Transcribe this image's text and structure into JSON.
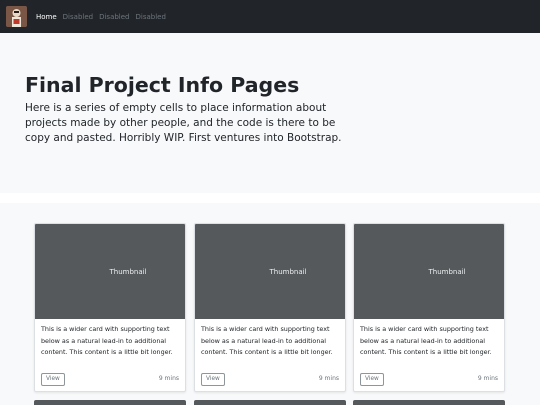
{
  "navbar": {
    "brand_icon": "avatar-logo",
    "links": [
      {
        "label": "Home",
        "state": "active"
      },
      {
        "label": "Disabled",
        "state": "disabled"
      },
      {
        "label": "Disabled",
        "state": "disabled"
      },
      {
        "label": "Disabled",
        "state": "disabled"
      }
    ]
  },
  "hero": {
    "title": "Final Project Info Pages",
    "lead": "Here is a series of empty cells to place information about projects made by other people, and the code is there to be copy and pasted. Horribly WIP. First ventures into Bootstrap."
  },
  "cards": [
    {
      "thumbnail": "Thumbnail",
      "text": "This is a wider card with supporting text below as a natural lead-in to additional content. This content is a little bit longer.",
      "button": "View",
      "time": "9 mins"
    },
    {
      "thumbnail": "Thumbnail",
      "text": "This is a wider card with supporting text below as a natural lead-in to additional content. This content is a little bit longer.",
      "button": "View",
      "time": "9 mins"
    },
    {
      "thumbnail": "Thumbnail",
      "text": "This is a wider card with supporting text below as a natural lead-in to additional content. This content is a little bit longer.",
      "button": "View",
      "time": "9 mins"
    }
  ],
  "colors": {
    "navbar": "#212529",
    "hero_bg": "#f8f9fa",
    "thumbnail_bg": "#55595c",
    "muted": "#6c757d"
  }
}
